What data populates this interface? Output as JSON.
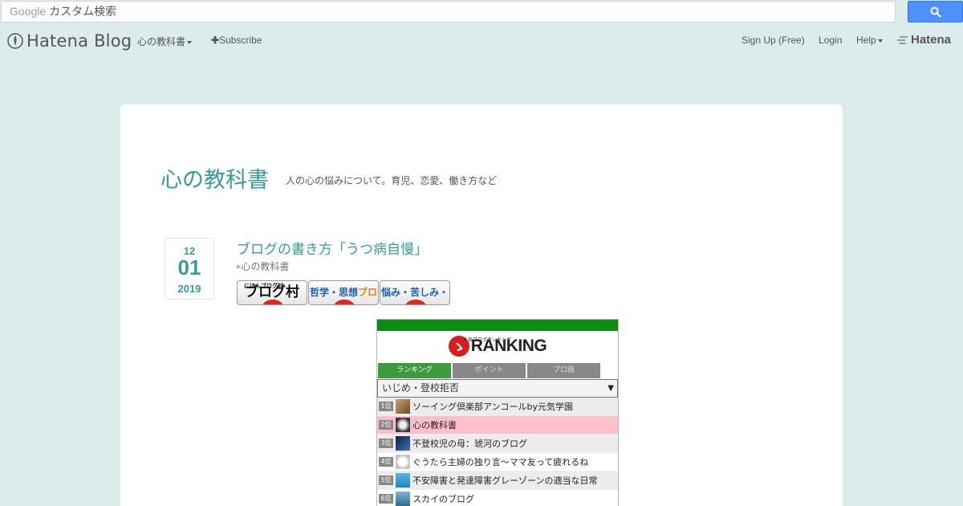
{
  "search": {
    "brand": "Google",
    "placeholder": "カスタム検索"
  },
  "header": {
    "logo_text": "Hatena Blog",
    "blog_menu": "心の教科書",
    "subscribe": "Subscribe",
    "signup": "Sign Up (Free)",
    "login": "Login",
    "help": "Help",
    "hatena_brand": "Hatena"
  },
  "blog": {
    "title": "心の教科書",
    "description": "人の心の悩みについて。育児、恋愛、働き方など"
  },
  "entry": {
    "date": {
      "month": "12",
      "day": "01",
      "year": "2019"
    },
    "title": "ブログの書き方「うつ病自慢」",
    "category": "心の教科書"
  },
  "banners": {
    "b1_small": "にほんブログ村",
    "b1_main": "ブログ村",
    "b2_main": "哲学・思想",
    "b2_orange": "ブログ",
    "b3_main": "悩み・苦しみ・迷い"
  },
  "ranking": {
    "logo_sub": "人気ブログランキング",
    "logo_text": "RANKING",
    "tabs": [
      "ランキング",
      "ポイント",
      "プロ画"
    ],
    "category": "いじめ・登校拒否",
    "rows": [
      {
        "rank": "1位",
        "name": "ソーイング倶楽部アンコールby元気学園"
      },
      {
        "rank": "2位",
        "name": "心の教科書"
      },
      {
        "rank": "3位",
        "name": "不登校児の母：琥河のブログ"
      },
      {
        "rank": "4位",
        "name": "ぐうたら主婦の独り言〜ママ友って疲れるね"
      },
      {
        "rank": "5位",
        "name": "不安障害と発達障害グレーゾーンの適当な日常"
      },
      {
        "rank": "6位",
        "name": "スカイのブログ"
      }
    ]
  },
  "colors": {
    "background": "#dcebeb",
    "accent": "#3a9b95",
    "ranking_green": "#0c8c10",
    "highlight": "#ffc0cb"
  }
}
